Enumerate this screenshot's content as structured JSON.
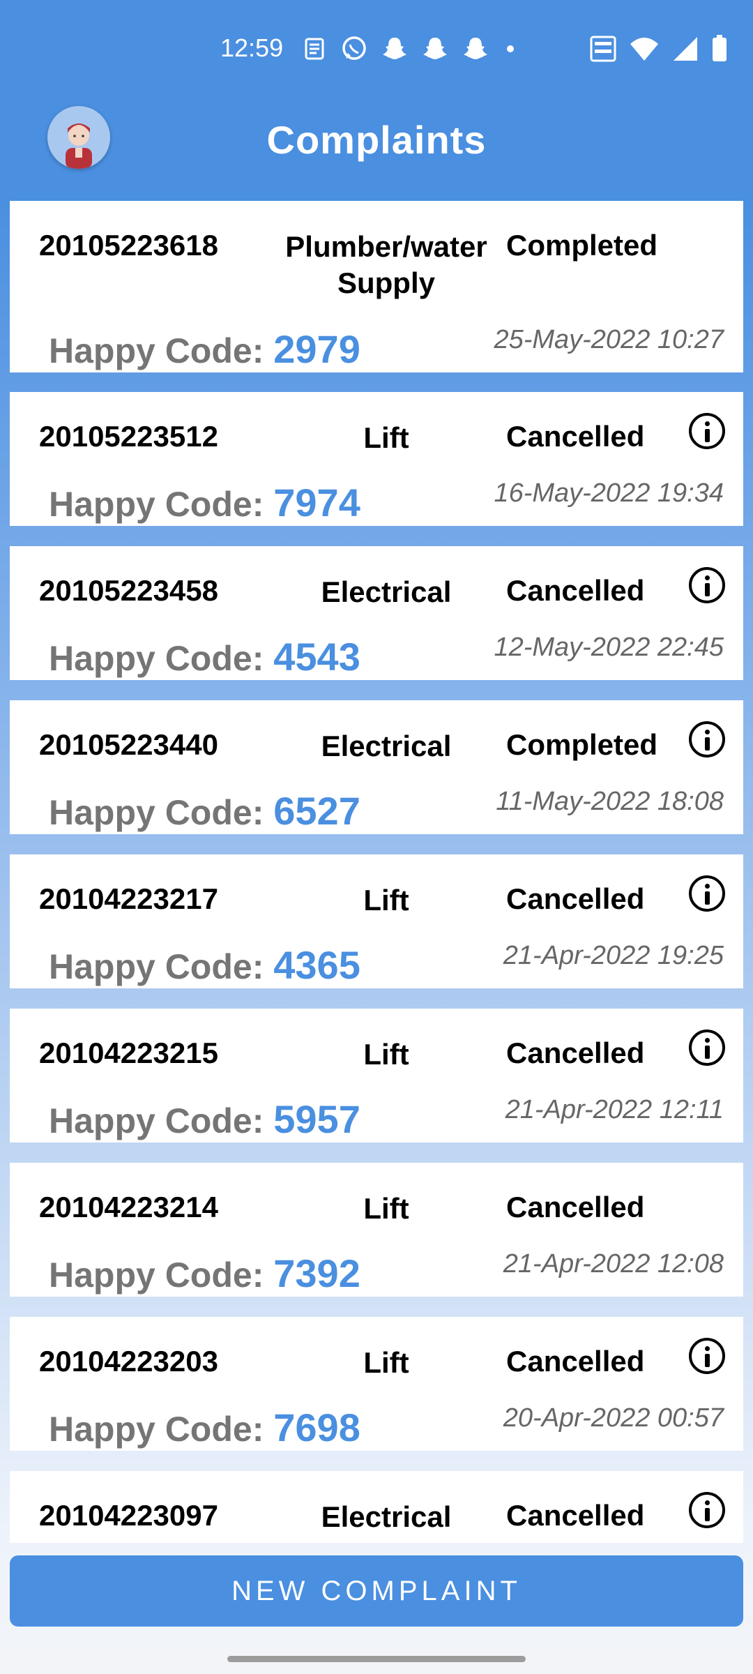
{
  "status_bar": {
    "time": "12:59"
  },
  "header": {
    "title": "Complaints"
  },
  "complaints": [
    {
      "id": "20105223618",
      "type": "Plumber/water Supply",
      "status": "Completed",
      "happy_label": "Happy Code:",
      "happy_code": "2979",
      "date": "25-May-2022 10:27",
      "has_info": false
    },
    {
      "id": "20105223512",
      "type": "Lift",
      "status": "Cancelled",
      "happy_label": "Happy Code:",
      "happy_code": "7974",
      "date": "16-May-2022 19:34",
      "has_info": true
    },
    {
      "id": "20105223458",
      "type": "Electrical",
      "status": "Cancelled",
      "happy_label": "Happy Code:",
      "happy_code": "4543",
      "date": "12-May-2022 22:45",
      "has_info": true
    },
    {
      "id": "20105223440",
      "type": "Electrical",
      "status": "Completed",
      "happy_label": "Happy Code:",
      "happy_code": "6527",
      "date": "11-May-2022 18:08",
      "has_info": true
    },
    {
      "id": "20104223217",
      "type": "Lift",
      "status": "Cancelled",
      "happy_label": "Happy Code:",
      "happy_code": "4365",
      "date": "21-Apr-2022 19:25",
      "has_info": true
    },
    {
      "id": "20104223215",
      "type": "Lift",
      "status": "Cancelled",
      "happy_label": "Happy Code:",
      "happy_code": "5957",
      "date": "21-Apr-2022 12:11",
      "has_info": true
    },
    {
      "id": "20104223214",
      "type": "Lift",
      "status": "Cancelled",
      "happy_label": "Happy Code:",
      "happy_code": "7392",
      "date": "21-Apr-2022 12:08",
      "has_info": false
    },
    {
      "id": "20104223203",
      "type": "Lift",
      "status": "Cancelled",
      "happy_label": "Happy Code:",
      "happy_code": "7698",
      "date": "20-Apr-2022 00:57",
      "has_info": true
    },
    {
      "id": "20104223097",
      "type": "Electrical",
      "status": "Cancelled",
      "happy_label": "",
      "happy_code": "",
      "date": "",
      "has_info": true
    }
  ],
  "new_complaint_button": "NEW COMPLAINT",
  "colors": {
    "primary": "#4a8fe0",
    "happy_label": "#757575"
  },
  "icons": [
    "news-icon",
    "whatsapp-icon",
    "snapchat-icon",
    "volte-icon",
    "wifi-icon",
    "signal-icon",
    "battery-icon",
    "avatar-icon",
    "info-icon"
  ]
}
